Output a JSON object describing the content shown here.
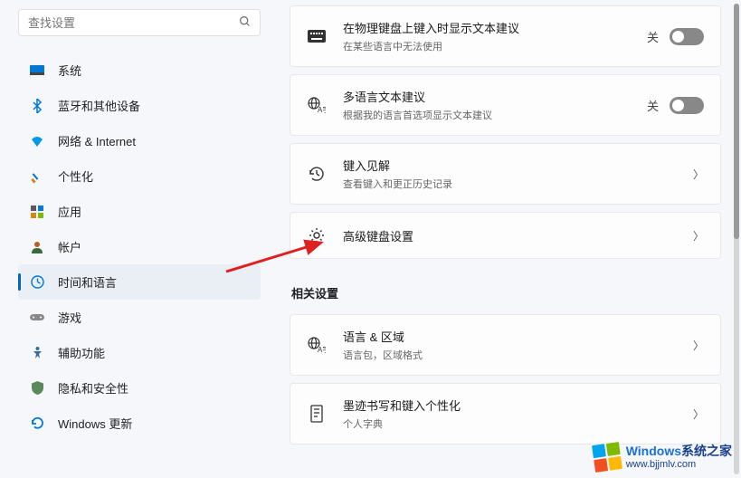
{
  "search": {
    "placeholder": "查找设置"
  },
  "sidebar": {
    "items": [
      {
        "label": "系统",
        "icon": "system"
      },
      {
        "label": "蓝牙和其他设备",
        "icon": "bluetooth"
      },
      {
        "label": "网络 & Internet",
        "icon": "network"
      },
      {
        "label": "个性化",
        "icon": "personalization"
      },
      {
        "label": "应用",
        "icon": "apps"
      },
      {
        "label": "帐户",
        "icon": "accounts"
      },
      {
        "label": "时间和语言",
        "icon": "time-language",
        "selected": true
      },
      {
        "label": "游戏",
        "icon": "gaming"
      },
      {
        "label": "辅助功能",
        "icon": "accessibility"
      },
      {
        "label": "隐私和安全性",
        "icon": "privacy"
      },
      {
        "label": "Windows 更新",
        "icon": "update"
      }
    ]
  },
  "main": {
    "cards": [
      {
        "title": "在物理键盘上键入时显示文本建议",
        "subtitle": "在某些语言中无法使用",
        "toggle": true,
        "toggle_state": "关",
        "icon": "keyboard"
      },
      {
        "title": "多语言文本建议",
        "subtitle": "根据我的语言首选项显示文本建议",
        "toggle": true,
        "toggle_state": "关",
        "icon": "multilang"
      },
      {
        "title": "键入见解",
        "subtitle": "查看键入和更正历史记录",
        "chevron": true,
        "icon": "history"
      },
      {
        "title": "高级键盘设置",
        "subtitle": "",
        "chevron": true,
        "icon": "gear"
      }
    ],
    "section_heading": "相关设置",
    "related": [
      {
        "title": "语言 & 区域",
        "subtitle": "语言包，区域格式",
        "icon": "language"
      },
      {
        "title": "墨迹书写和键入个性化",
        "subtitle": "个人字典",
        "icon": "ink"
      }
    ]
  },
  "watermark": {
    "brand_blue": "Windows",
    "brand_rest": "系统之家",
    "url": "www.bjjmlv.com"
  }
}
